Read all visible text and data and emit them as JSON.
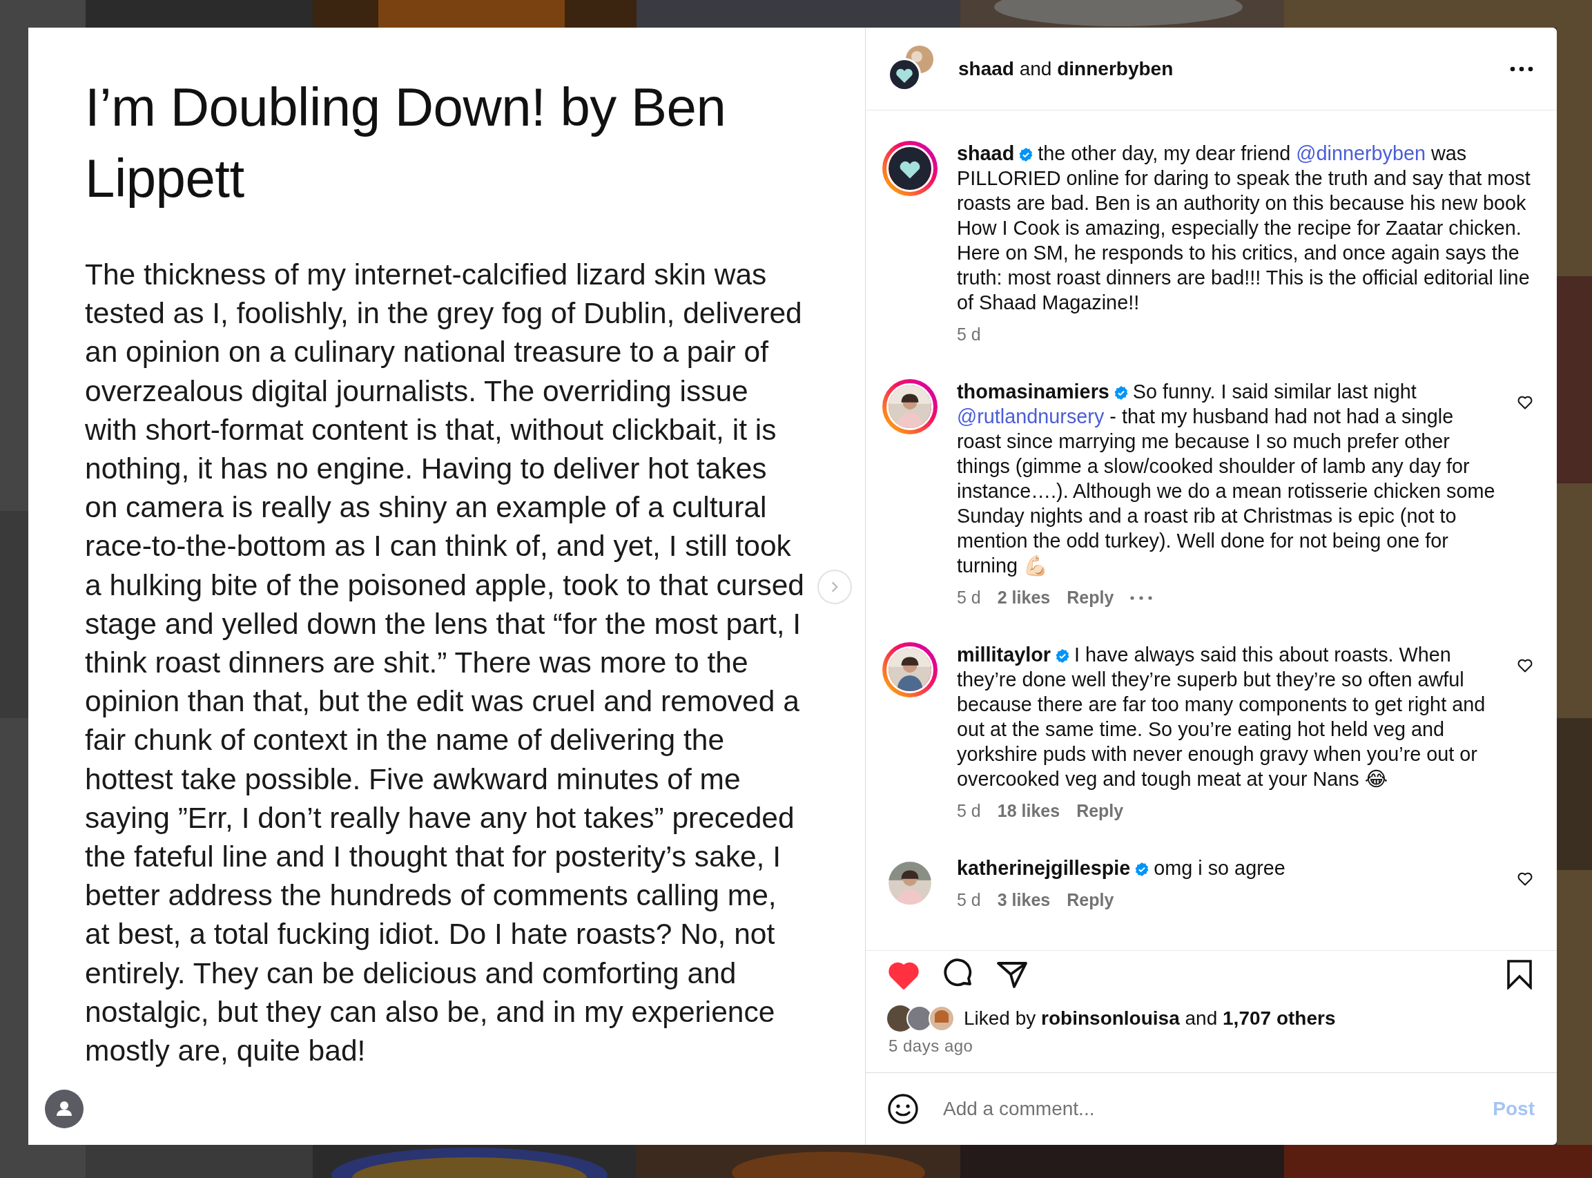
{
  "post": {
    "title": "I’m Doubling Down! by Ben Lippett",
    "body": "The thickness of my internet-calcified lizard skin was tested as I, foolishly, in the grey fog of Dublin, delivered an opinion on a culinary national treasure to a pair of overzealous digital journalists. The overriding issue with short-format content is that, without clickbait, it is nothing, it has no engine. Having to deliver hot takes on camera is really as shiny an example of a cultural race-to-the-bottom as I can think of, and yet, I still took a hulking bite of the poisoned apple, took to that cursed stage and yelled down the lens that “for the most part, I think roast dinners are shit.” There was more to the opinion than that, but the edit was cruel and removed a fair chunk of context in the name of delivering the hottest take possible. Five awkward minutes of me saying ”Err, I don’t really have any hot takes” preceded the fateful line and I thought that for posterity’s sake, I better address the hundreds of comments calling me, at best, a total fucking idiot. Do I hate roasts? No, not entirely. They can be delicious and comforting and nostalgic, but they can also be, and in my experience mostly are, quite bad!"
  },
  "header": {
    "authors": "**shaad** and **dinnerbyben**"
  },
  "comments": [
    {
      "username": "shaad",
      "verified": true,
      "story_ring": true,
      "segments": [
        {
          "kind": "text",
          "text": "the other day, my dear friend "
        },
        {
          "kind": "mention",
          "text": "@dinnerbyben"
        },
        {
          "kind": "text",
          "text": " was PILLORIED online for daring to speak the truth and say that most roasts are bad. Ben is an authority on this because his new book How I Cook is amazing, especially the recipe for Zaatar chicken. Here on SM, he responds to his critics, and once again says the truth: most roast dinners are bad!!! This is the official editorial line of Shaad Magazine!!"
        }
      ],
      "time": "5 d"
    },
    {
      "username": "thomasinamiers",
      "verified": true,
      "story_ring": true,
      "liked": false,
      "segments": [
        {
          "kind": "text",
          "text": "So funny. I said similar last night "
        },
        {
          "kind": "mention",
          "text": "@rutlandnursery"
        },
        {
          "kind": "text",
          "text": " - that my husband had not had a single roast since marrying me because I so much prefer other things (gimme a slow/cooked shoulder of lamb any day for instance….). Although we do a mean rotisserie chicken some Sunday nights and a roast rib at Christmas is epic (not to mention the odd turkey). Well done for not being one for turning 💪🏻"
        }
      ],
      "time": "5 d",
      "likes": "2 likes",
      "reply": "Reply",
      "more": true
    },
    {
      "username": "millitaylor",
      "verified": true,
      "story_ring": true,
      "liked": false,
      "segments": [
        {
          "kind": "text",
          "text": "I have always said this about roasts. When they’re done well they’re superb but they’re so often awful because there are far too many components to get right and out at the same time. So you’re eating hot held veg and yorkshire puds with never enough gravy when you’re out or overcooked veg and tough meat at your Nans 😂"
        }
      ],
      "time": "5 d",
      "likes": "18 likes",
      "reply": "Reply",
      "more": false
    },
    {
      "username": "katherinejgillespie",
      "verified": true,
      "story_ring": false,
      "liked": false,
      "segments": [
        {
          "kind": "text",
          "text": "omg i so agree"
        }
      ],
      "time": "5 d",
      "likes": "3 likes",
      "reply": "Reply",
      "more": false
    }
  ],
  "actions": {
    "liked": true,
    "saved": false
  },
  "likes": {
    "text": "Liked by **robinsonlouisa** and **1,707 others**",
    "time": "5 days ago"
  },
  "composer": {
    "placeholder": "Add a comment...",
    "post": "Post",
    "disabled": true
  }
}
